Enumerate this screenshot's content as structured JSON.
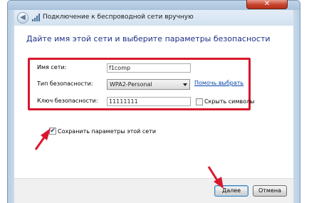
{
  "window": {
    "title": "Подключение к беспроводной сети вручную",
    "close_glyph": "✕",
    "back_glyph": "◀"
  },
  "heading": "Дайте имя этой сети и выберите параметры безопасности",
  "form": {
    "network_name": {
      "label": "Имя сети:",
      "value": "f1comp"
    },
    "security_type": {
      "label": "Тип безопасности:",
      "value": "WPA2-Personal",
      "help_link": "Помочь выбрать"
    },
    "security_key": {
      "label": "Ключ безопасности:",
      "value": "11111111",
      "hide_chars_label": "Скрыть символы",
      "hide_chars_checked": false
    }
  },
  "save_settings": {
    "label": "Сохранить параметры этой сети",
    "checked": true,
    "check_glyph": "✔"
  },
  "buttons": {
    "next": "Далее",
    "cancel": "Отмена"
  },
  "colors": {
    "highlight_red": "#d9182d",
    "heading_blue": "#1e3287",
    "link_blue": "#0645ad"
  }
}
